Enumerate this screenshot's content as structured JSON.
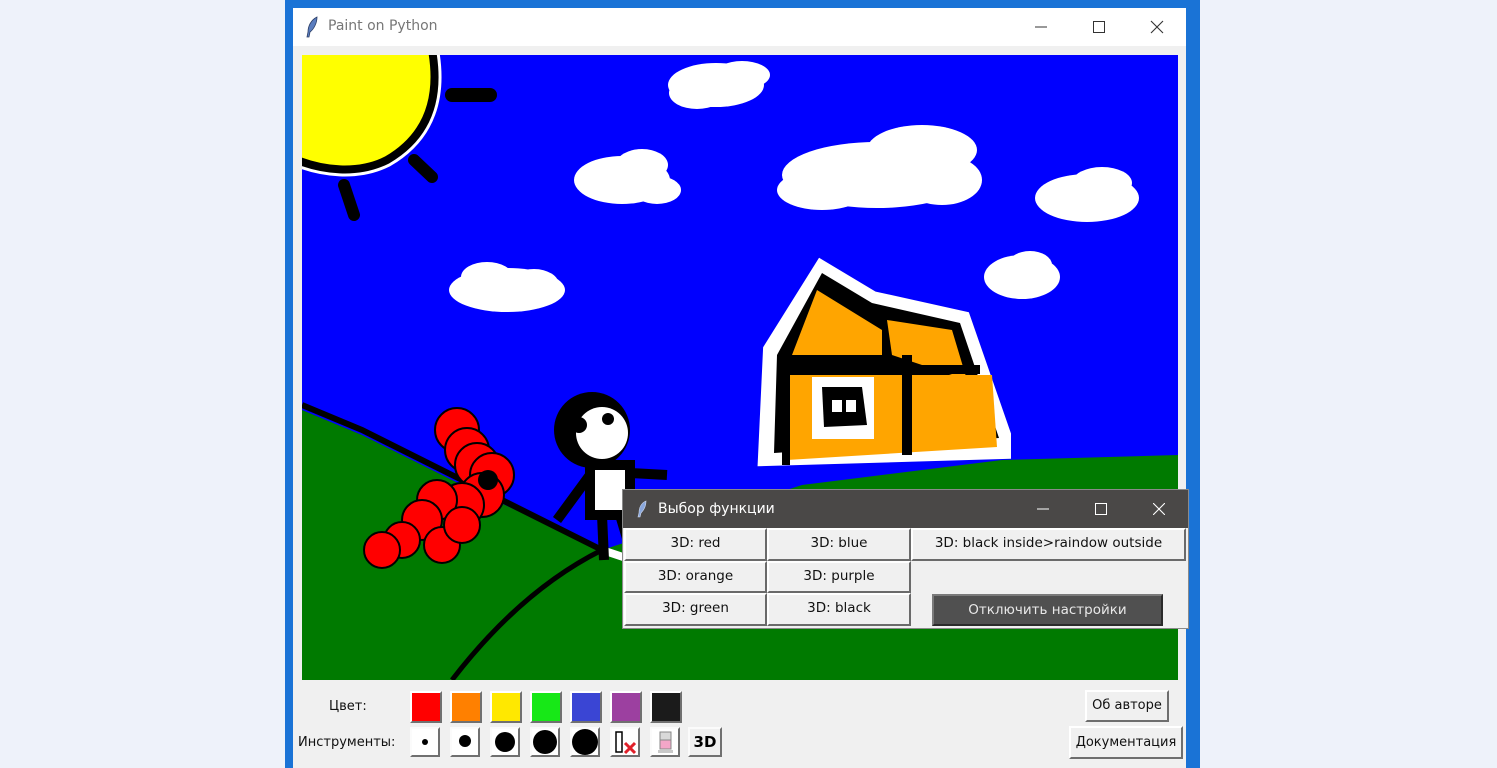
{
  "main_window": {
    "title": "Paint on Python"
  },
  "toolbar": {
    "color_label": "Цвет:",
    "tools_label": "Инструменты:",
    "colors": [
      {
        "name": "red",
        "hex": "#ff0000"
      },
      {
        "name": "orange",
        "hex": "#ff8000"
      },
      {
        "name": "yellow",
        "hex": "#ffe800"
      },
      {
        "name": "green",
        "hex": "#17e817"
      },
      {
        "name": "blue",
        "hex": "#3a45d4"
      },
      {
        "name": "purple",
        "hex": "#9c40a0"
      },
      {
        "name": "black",
        "hex": "#1b1b1b"
      }
    ],
    "tools": [
      "brush-size-1-icon",
      "brush-size-2-icon",
      "brush-size-3-icon",
      "brush-size-4-icon",
      "brush-size-5-icon",
      "clear-canvas-icon",
      "eraser-icon"
    ],
    "three_d_label": "3D",
    "about_label": "Об авторе",
    "docs_label": "Документация"
  },
  "popup": {
    "title": "Выбор функции",
    "buttons": {
      "red": "3D: red",
      "blue": "3D: blue",
      "rainbow": "3D: black inside>raindow outside",
      "orange": "3D: orange",
      "purple": "3D: purple",
      "green": "3D: green",
      "black": "3D: black"
    },
    "disable_label": "Отключить настройки"
  },
  "canvas_colors": {
    "sky": "#0000ff",
    "grass": "#007a00",
    "sun": "#ffff00",
    "house": "#ffa500"
  }
}
